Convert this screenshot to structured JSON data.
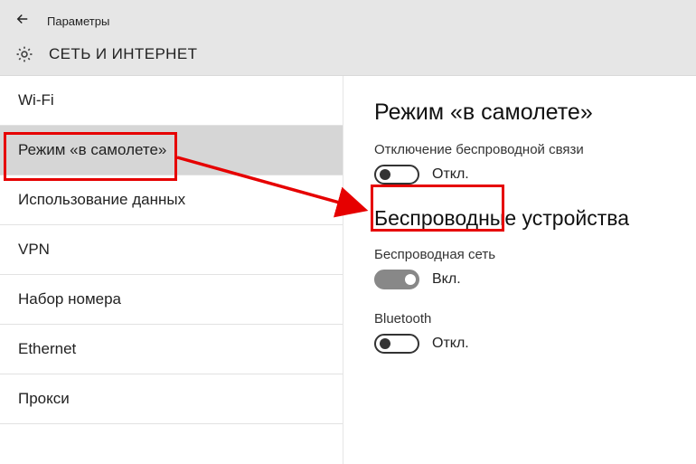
{
  "header": {
    "back_aria": "Назад",
    "title_small": "Параметры",
    "section_title": "СЕТЬ И ИНТЕРНЕТ"
  },
  "sidebar": {
    "items": [
      {
        "label": "Wi-Fi",
        "selected": false
      },
      {
        "label": "Режим «в самолете»",
        "selected": true
      },
      {
        "label": "Использование данных",
        "selected": false
      },
      {
        "label": "VPN",
        "selected": false
      },
      {
        "label": "Набор номера",
        "selected": false
      },
      {
        "label": "Ethernet",
        "selected": false
      },
      {
        "label": "Прокси",
        "selected": false
      }
    ]
  },
  "content": {
    "heading": "Режим «в самолете»",
    "airplane": {
      "label": "Отключение беспроводной связи",
      "state_text": "Откл.",
      "on": false
    },
    "wireless_heading": "Беспроводные устройства",
    "wifi": {
      "label": "Беспроводная сеть",
      "state_text": "Вкл.",
      "on": true
    },
    "bluetooth": {
      "label": "Bluetooth",
      "state_text": "Откл.",
      "on": false
    }
  }
}
